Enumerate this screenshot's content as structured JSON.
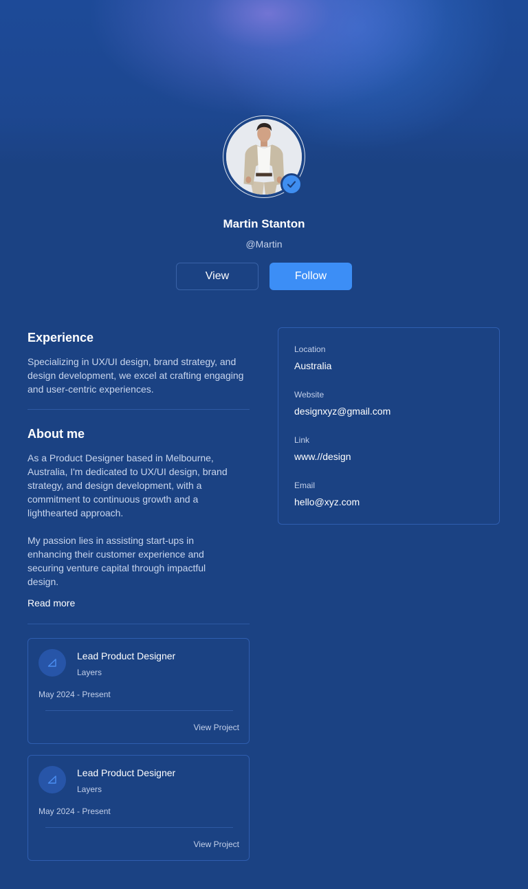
{
  "profile": {
    "name": "Martin Stanton",
    "handle": "@Martin",
    "verified_icon": "check-badge-icon",
    "view_label": "View",
    "follow_label": "Follow"
  },
  "experience": {
    "title": "Experience",
    "text": "Specializing in UX/UI design, brand strategy, and design development, we excel at crafting engaging and user-centric experiences."
  },
  "about": {
    "title": "About me",
    "paragraph1": "As a Product Designer based in Melbourne, Australia, I'm dedicated to UX/UI design, brand strategy, and design development, with a commitment to continuous growth and a lighthearted approach.",
    "paragraph2": "My passion lies in assisting start-ups in enhancing their customer experience and securing venture capital through impactful design.",
    "read_more": "Read more"
  },
  "jobs": [
    {
      "title": "Lead Product Designer",
      "company": "Layers",
      "dates": "May 2024 - Present",
      "link": "View Project",
      "icon": "layers-logo-icon"
    },
    {
      "title": "Lead Product Designer",
      "company": "Layers",
      "dates": "May 2024 - Present",
      "link": "View Project",
      "icon": "layers-logo-icon"
    }
  ],
  "info": {
    "location_label": "Location",
    "location_value": "Australia",
    "website_label": "Website",
    "website_value": "designxyz@gmail.com",
    "link_label": "Link",
    "link_value": "www.//design",
    "email_label": "Email",
    "email_value": "hello@xyz.com"
  },
  "colors": {
    "background": "#1b4283",
    "accent": "#3c8ef6",
    "card_border": "#2f5eb0",
    "muted_text": "#c3d0ea"
  }
}
